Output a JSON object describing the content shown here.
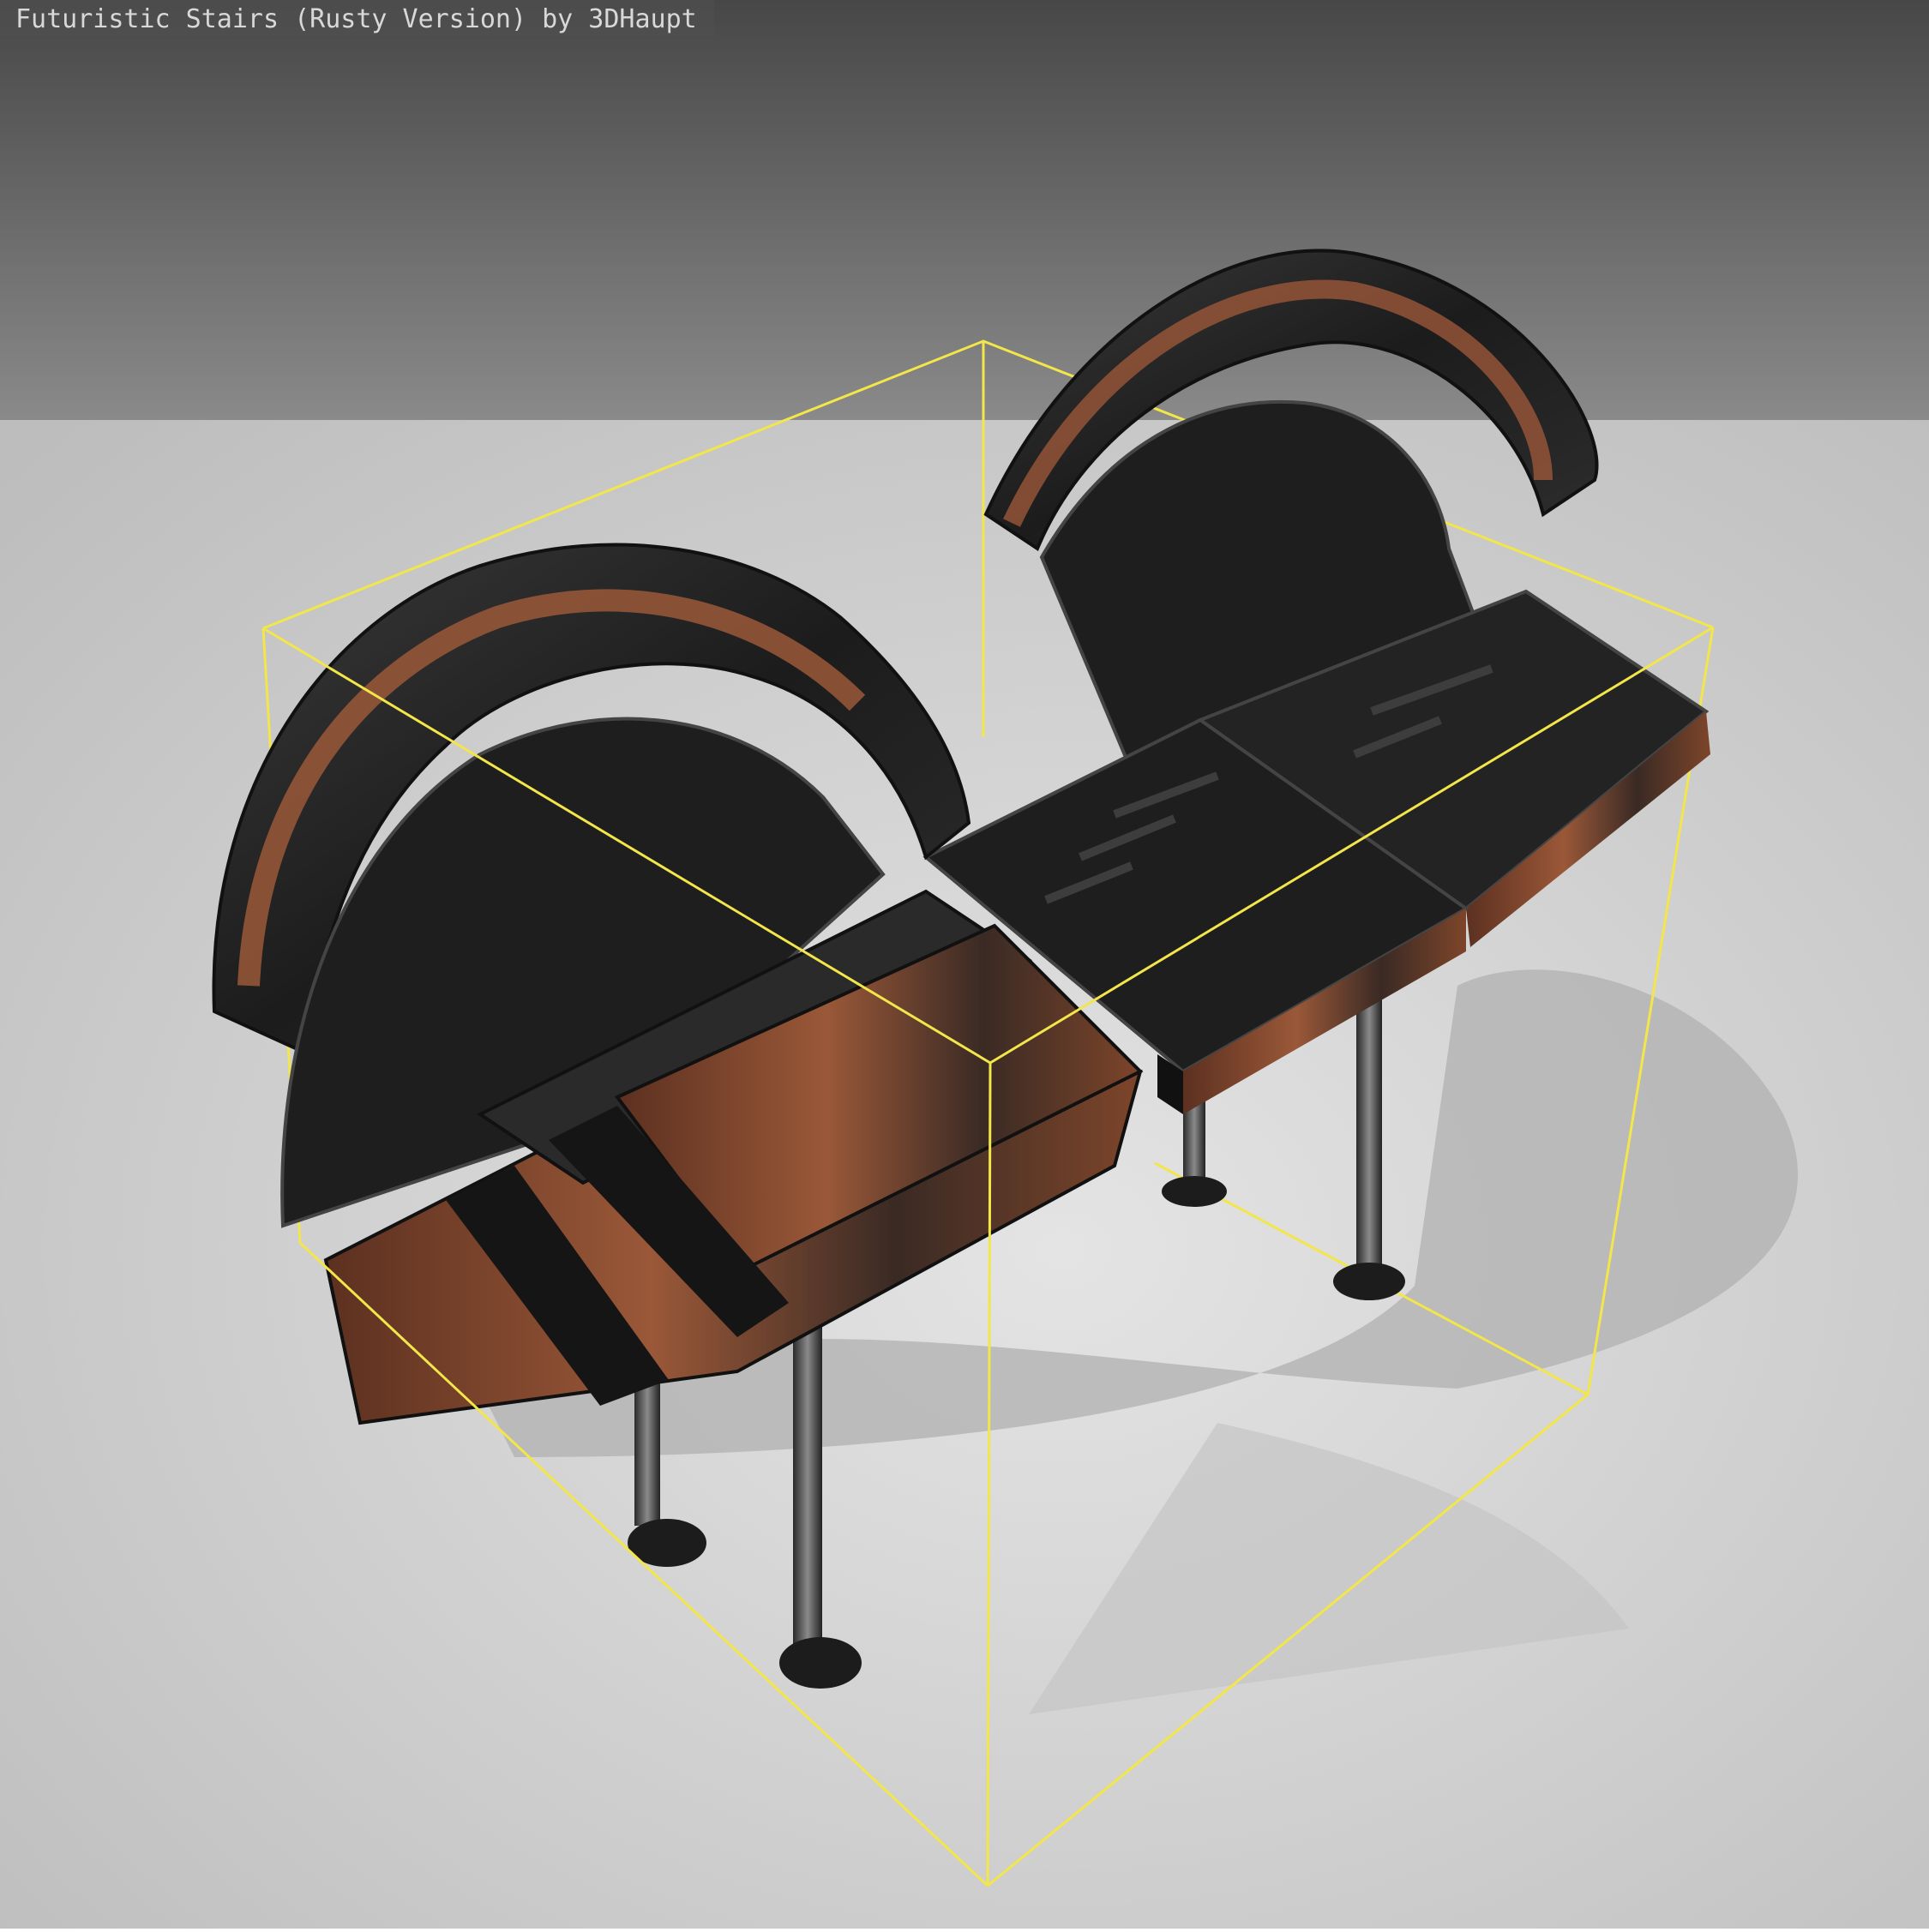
{
  "viewer": {
    "title": "Futuristic Stairs (Rusty Version) by 3DHaupt",
    "bbox_color": "#f2e64a",
    "background_top": "#4a4a4a",
    "background_floor": "#d9d9d9"
  },
  "model": {
    "name": "futuristic-stairs",
    "metal_color": "#1e1e1e",
    "rust_color": "#8a4a2a"
  }
}
